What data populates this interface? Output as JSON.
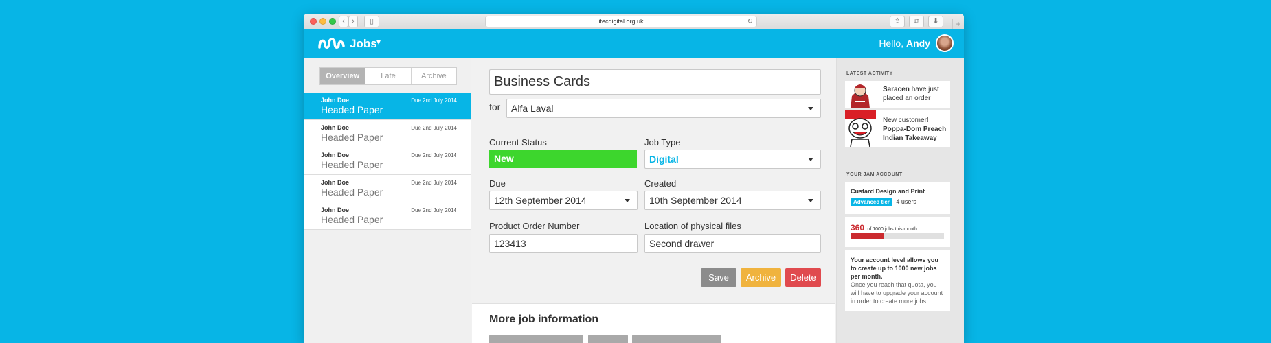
{
  "browser": {
    "url": "itecdigital.org.uk"
  },
  "header": {
    "app_title": "Jobs",
    "greeting": "Hello,",
    "user_name": "Andy"
  },
  "sidebar": {
    "tabs": [
      {
        "label": "Overview"
      },
      {
        "label": "Late"
      },
      {
        "label": "Archive"
      }
    ],
    "jobs": [
      {
        "customer": "John Doe",
        "due": "Due 2nd July 2014",
        "title": "Headed Paper"
      },
      {
        "customer": "John Doe",
        "due": "Due 2nd July 2014",
        "title": "Headed Paper"
      },
      {
        "customer": "John Doe",
        "due": "Due 2nd July 2014",
        "title": "Headed Paper"
      },
      {
        "customer": "John Doe",
        "due": "Due 2nd July 2014",
        "title": "Headed Paper"
      },
      {
        "customer": "John Doe",
        "due": "Due 2nd July 2014",
        "title": "Headed Paper"
      }
    ]
  },
  "form": {
    "job_name": "Business Cards",
    "for_label": "for",
    "client": "Alfa Laval",
    "status_label": "Current Status",
    "status_value": "New",
    "job_type_label": "Job Type",
    "job_type_value": "Digital",
    "due_label": "Due",
    "due_value": "12th September 2014",
    "created_label": "Created",
    "created_value": "10th September 2014",
    "po_label": "Product Order Number",
    "po_value": "123413",
    "location_label": "Location of physical files",
    "location_value": "Second drawer",
    "save_label": "Save",
    "archive_label": "Archive",
    "delete_label": "Delete",
    "more_title": "More job information"
  },
  "activity": {
    "section_title": "LATEST ACTIVITY",
    "items": [
      {
        "bold": "Saracen",
        "text": "have just placed an order"
      },
      {
        "prefix": "New customer!",
        "bold": "Poppa-Dom Preach Indian Takeaway"
      }
    ]
  },
  "account": {
    "section_title": "YOUR JAM ACCOUNT",
    "company": "Custard Design and Print",
    "tier": "Advanced tier",
    "users": "4 users",
    "jobs_count": "360",
    "jobs_text": "of 1000 jobs this month",
    "jobs_fraction": 0.36,
    "notice_bold": "Your account level allows you to create up to 1000 new jobs per month.",
    "notice_text": "Once you reach that quota, you will have to upgrade your account in order to create more jobs."
  },
  "colors": {
    "brand": "#07b5e6",
    "status_new": "#3dd62d",
    "save": "#8c8c8c",
    "archive": "#f0b33e",
    "delete": "#e04a4e",
    "usage_bar": "#cb2a2f"
  }
}
